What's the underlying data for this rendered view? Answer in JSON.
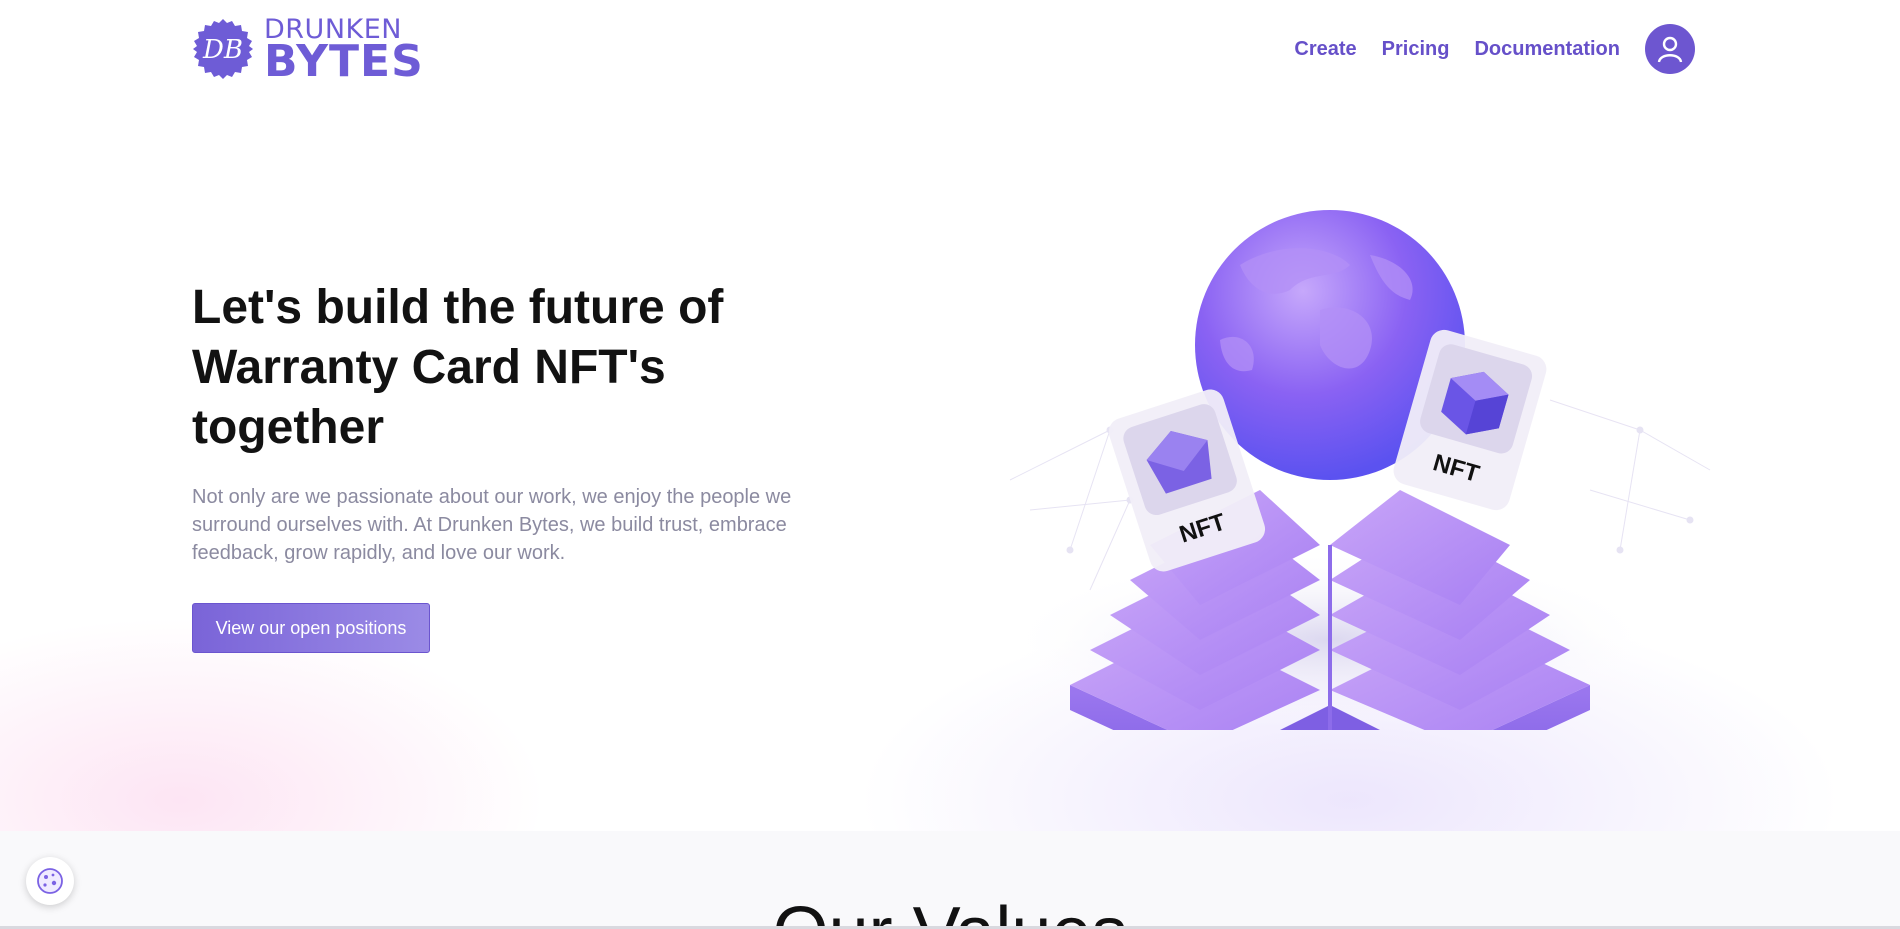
{
  "brand": {
    "logo_initials": "DB",
    "name_line1": "DRUNKEN",
    "name_line2": "BYTES",
    "accent_color": "#6e5cd6"
  },
  "nav": {
    "items": [
      {
        "label": "Create"
      },
      {
        "label": "Pricing"
      },
      {
        "label": "Documentation"
      }
    ],
    "avatar_icon": "user-icon"
  },
  "hero": {
    "title": "Let's build the future of Warranty Card NFT's together",
    "description": "Not only are we passionate about our work, we enjoy the people we surround ourselves with. At Drunken Bytes, we build trust, embrace feedback, grow rapidly, and love our work.",
    "cta_label": "View our open positions",
    "illustration": {
      "card_left_label": "NFT",
      "card_right_label": "NFT"
    }
  },
  "values": {
    "heading": "Our Values"
  },
  "cookie": {
    "icon": "cookie-icon"
  }
}
